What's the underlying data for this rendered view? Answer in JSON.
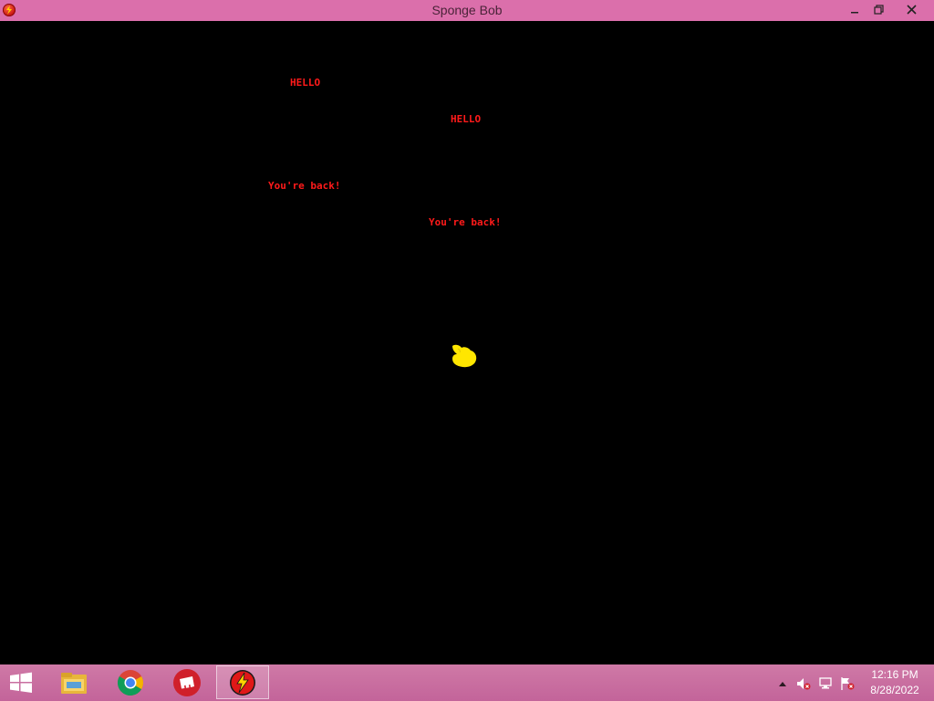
{
  "window": {
    "title": "Sponge Bob"
  },
  "game": {
    "messages": [
      {
        "text": "HELLO"
      },
      {
        "text": "HELLO"
      },
      {
        "text": "You're back!"
      },
      {
        "text": "You're back!"
      }
    ],
    "text_color": "#ff1a1a",
    "sprite_color": "#ffe600"
  },
  "taskbar": {
    "apps": [
      {
        "name": "file-explorer-icon"
      },
      {
        "name": "chrome-icon"
      },
      {
        "name": "riot-client-icon"
      },
      {
        "name": "game-app-icon"
      }
    ],
    "clock": {
      "time": "12:16 PM",
      "date": "8/28/2022"
    }
  },
  "colors": {
    "titlebar": "#db6fab",
    "taskbar": "#c86a9b",
    "background": "#000000"
  }
}
